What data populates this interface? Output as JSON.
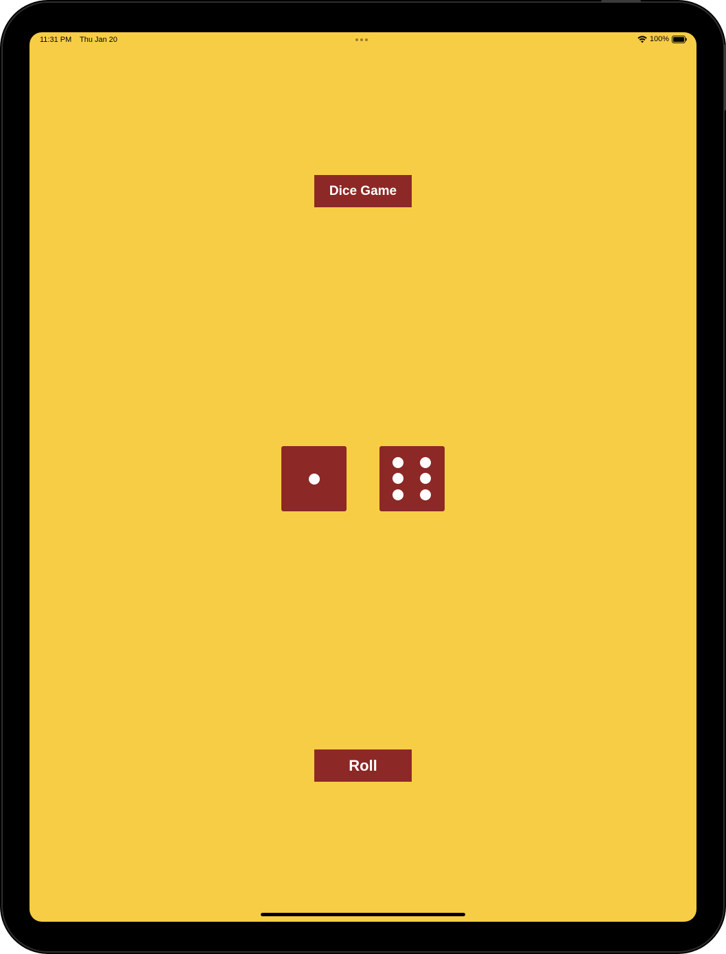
{
  "status_bar": {
    "time": "11:31 PM",
    "date": "Thu Jan 20",
    "battery": "100%",
    "wifi_icon": "wifi-icon",
    "battery_icon": "battery-full-icon"
  },
  "app": {
    "title": "Dice Game",
    "roll_label": "Roll",
    "background_color": "#F8CD46",
    "accent_color": "#8C2826"
  },
  "dice": [
    {
      "name": "die-left",
      "value": 1
    },
    {
      "name": "die-right",
      "value": 6
    }
  ]
}
